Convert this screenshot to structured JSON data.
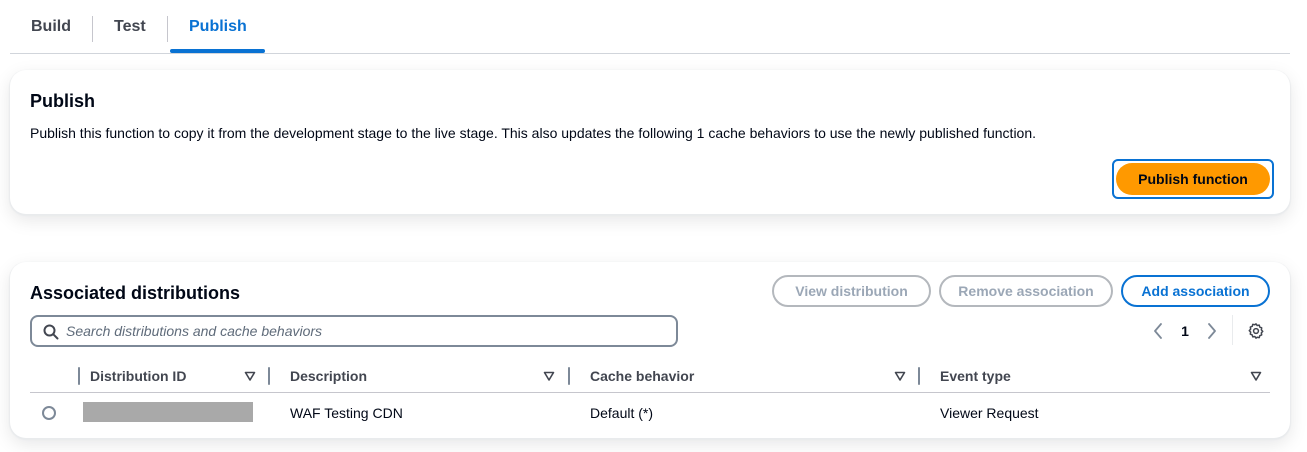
{
  "tabs": [
    {
      "label": "Build",
      "active": false
    },
    {
      "label": "Test",
      "active": false
    },
    {
      "label": "Publish",
      "active": true
    }
  ],
  "publish": {
    "title": "Publish",
    "description": "Publish this function to copy it from the development stage to the live stage. This also updates the following 1 cache behaviors to use the newly published function.",
    "button_label": "Publish function"
  },
  "associations": {
    "title": "Associated distributions",
    "buttons": {
      "view": "View distribution",
      "remove": "Remove association",
      "add": "Add association"
    },
    "search": {
      "placeholder": "Search distributions and cache behaviors",
      "value": ""
    },
    "pagination": {
      "current_page": "1"
    },
    "columns": [
      "Distribution ID",
      "Description",
      "Cache behavior",
      "Event type"
    ],
    "rows": [
      {
        "distribution_id": "",
        "description": "WAF Testing CDN",
        "cache_behavior": "Default (*)",
        "event_type": "Viewer Request"
      }
    ]
  },
  "colors": {
    "accent": "#0972d3",
    "primary_button": "#ff9900",
    "disabled": "#9ba7b6",
    "text": "#000716",
    "muted": "#424650"
  },
  "icons": [
    "search-icon",
    "chevron-left-icon",
    "chevron-right-icon",
    "gear-icon",
    "sort-caret-icon"
  ]
}
